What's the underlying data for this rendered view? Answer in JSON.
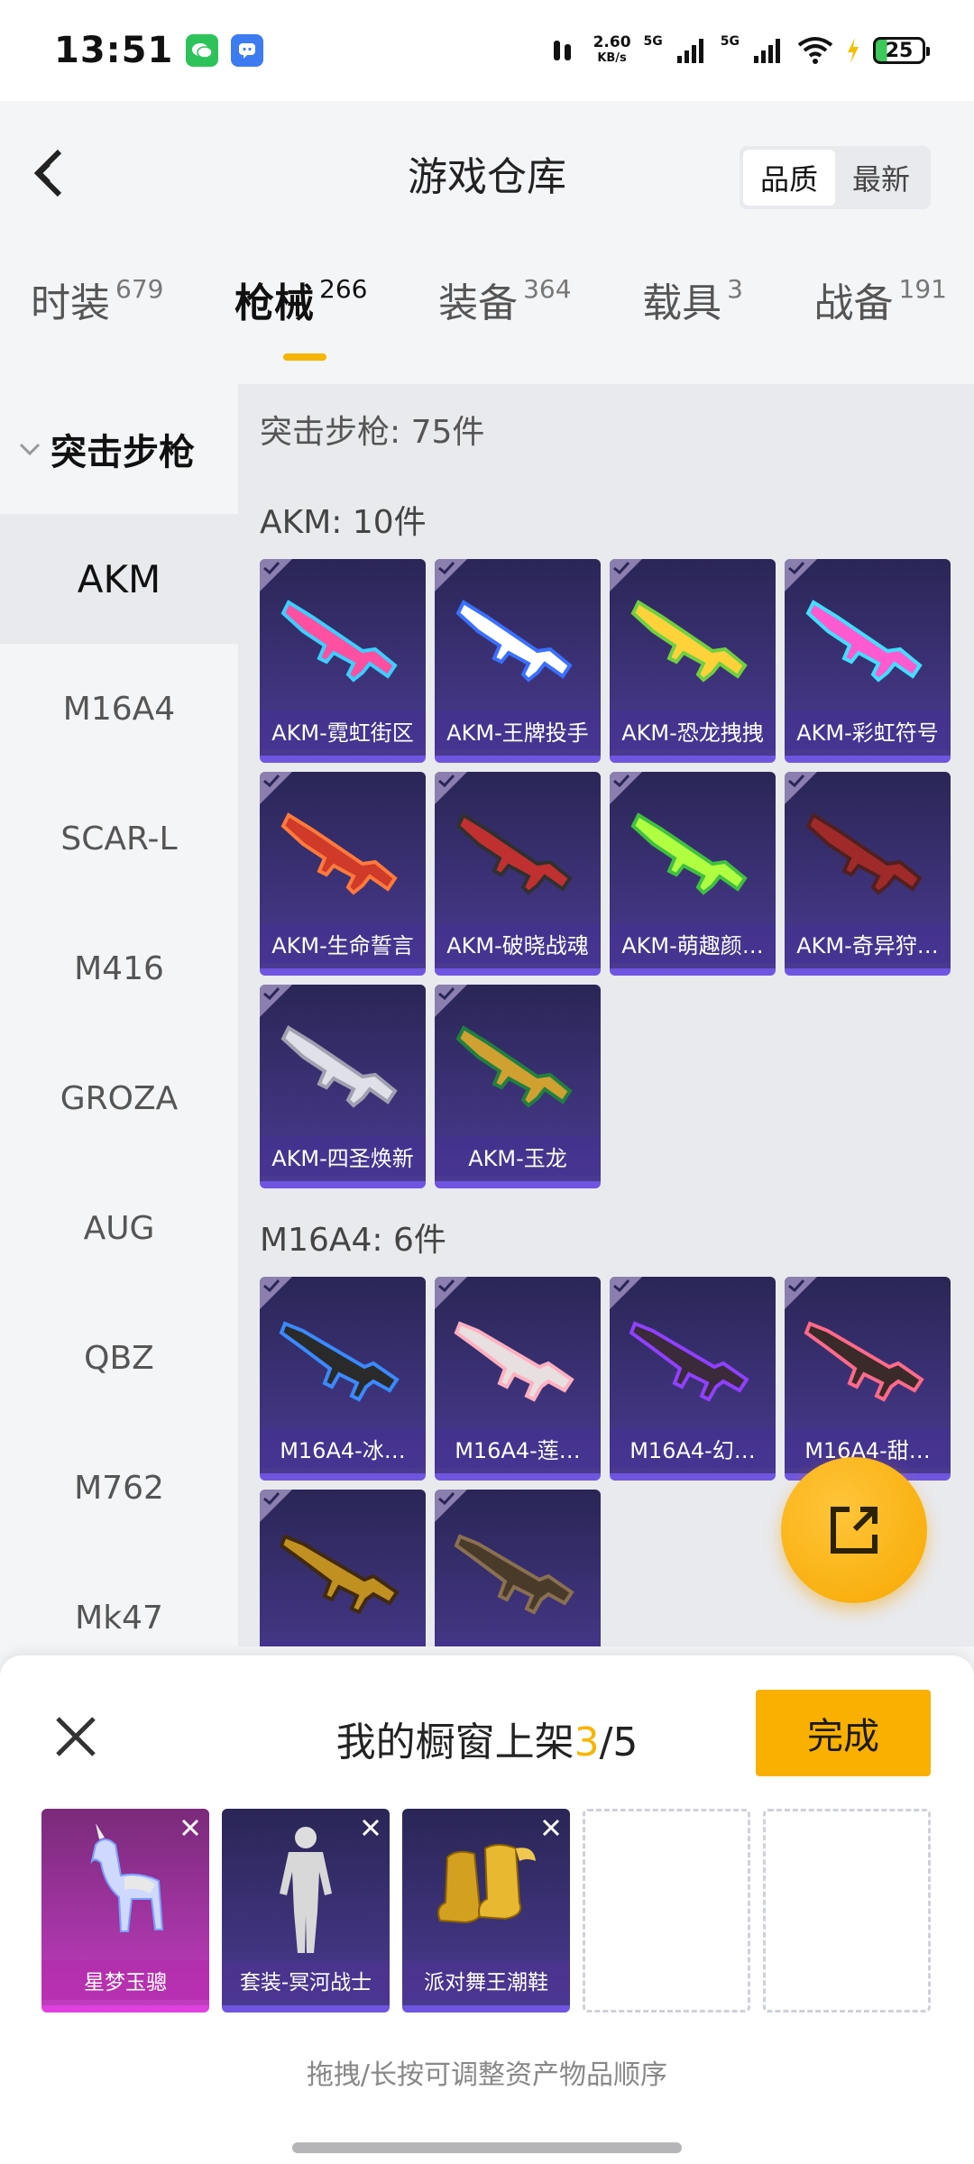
{
  "status": {
    "time": "13:51",
    "speed_top": "2.60",
    "speed_unit": "KB/s",
    "net1": "5G",
    "net2": "5G",
    "battery": "25"
  },
  "header": {
    "title": "游戏仓库",
    "sort": [
      "品质",
      "最新"
    ]
  },
  "tabs": [
    {
      "label": "时装",
      "count": "679"
    },
    {
      "label": "枪械",
      "count": "266"
    },
    {
      "label": "装备",
      "count": "364"
    },
    {
      "label": "载具",
      "count": "3"
    },
    {
      "label": "战备",
      "count": "191"
    }
  ],
  "sidebar": {
    "group": "突击步枪",
    "items": [
      "AKM",
      "M16A4",
      "SCAR-L",
      "M416",
      "GROZA",
      "AUG",
      "QBZ",
      "M762",
      "Mk47"
    ]
  },
  "main": {
    "header": "突击步枪: 75件",
    "sections": [
      {
        "title": "AKM: 10件",
        "items": [
          "AKM-霓虹街区",
          "AKM-王牌投手",
          "AKM-恐龙拽拽",
          "AKM-彩虹符号",
          "AKM-生命誓言",
          "AKM-破晓战魂",
          "AKM-萌趣颜…",
          "AKM-奇异狩…",
          "AKM-四圣焕新",
          "AKM-玉龙"
        ]
      },
      {
        "title": "M16A4: 6件",
        "items": [
          "M16A4-冰…",
          "M16A4-莲…",
          "M16A4-幻…",
          "M16A4-甜…",
          "",
          ""
        ]
      }
    ]
  },
  "sheet": {
    "title_prefix": "我的橱窗上架",
    "count": "3",
    "total": "/5",
    "done": "完成",
    "slots": [
      "星梦玉骢",
      "套装-冥河战士",
      "派对舞王潮鞋"
    ],
    "hint": "拖拽/长按可调整资产物品顺序"
  },
  "colors": {
    "accent": "#f7b500",
    "card_bg": "#3a3278",
    "card_border": "#6f55e0"
  }
}
